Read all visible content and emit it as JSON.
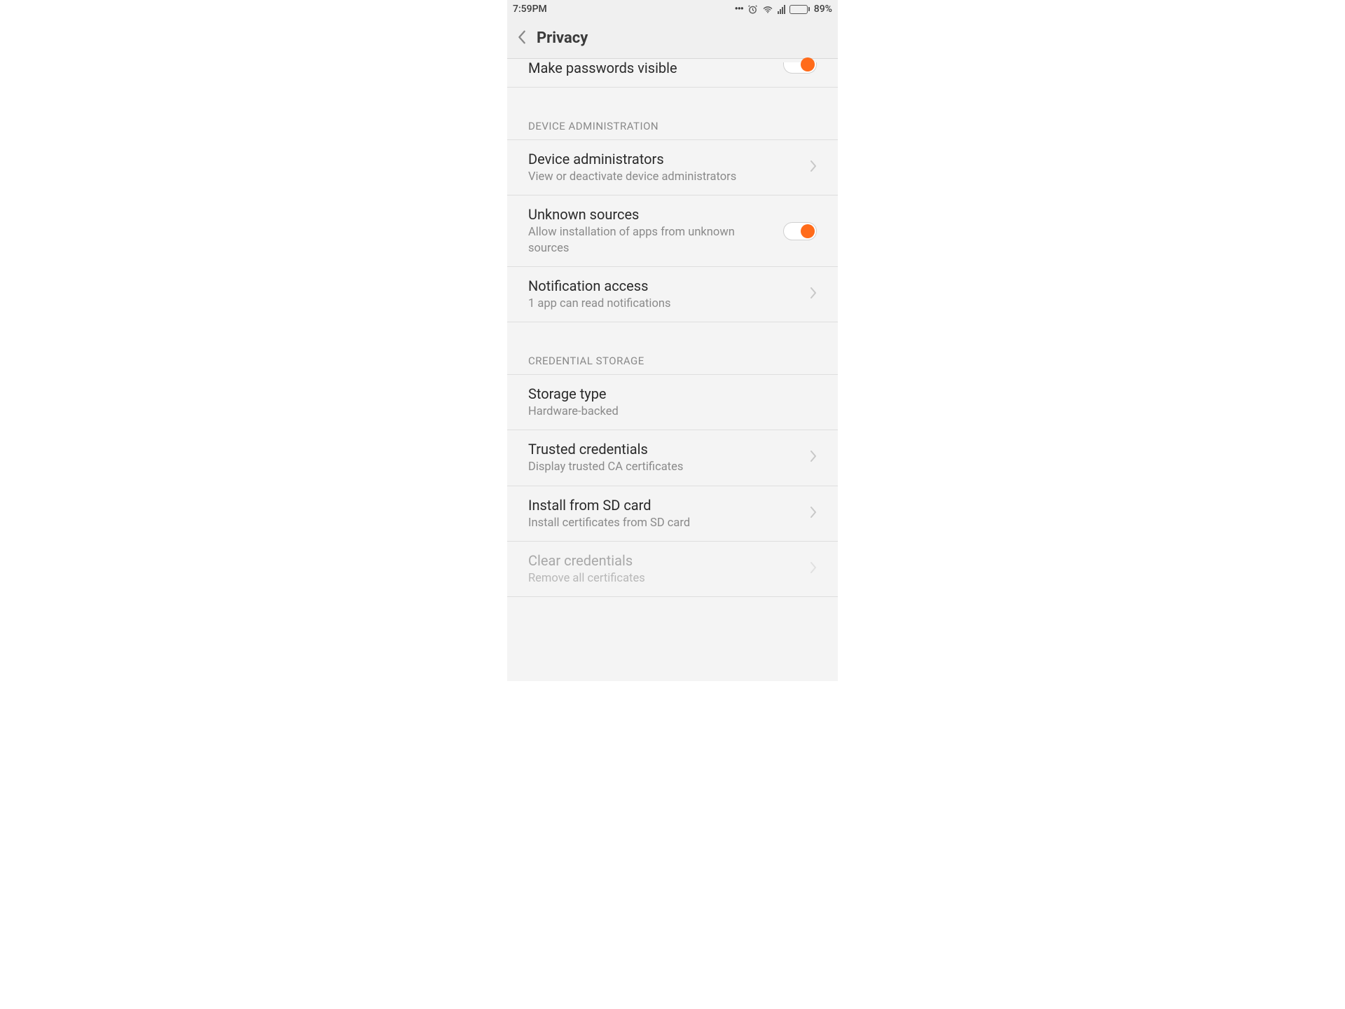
{
  "status_bar": {
    "time": "7:59PM",
    "battery_percent": "89%"
  },
  "header": {
    "title": "Privacy"
  },
  "rows": {
    "make_passwords_visible": {
      "title": "Make passwords visible"
    }
  },
  "sections": {
    "device_admin": {
      "header": "DEVICE ADMINISTRATION",
      "device_administrators": {
        "title": "Device administrators",
        "subtitle": "View or deactivate device administrators"
      },
      "unknown_sources": {
        "title": "Unknown sources",
        "subtitle": "Allow installation of apps from unknown sources"
      },
      "notification_access": {
        "title": "Notification access",
        "subtitle": "1 app can read notifications"
      }
    },
    "credential_storage": {
      "header": "CREDENTIAL STORAGE",
      "storage_type": {
        "title": "Storage type",
        "subtitle": "Hardware-backed"
      },
      "trusted_credentials": {
        "title": "Trusted credentials",
        "subtitle": "Display trusted CA certificates"
      },
      "install_sd": {
        "title": "Install from SD card",
        "subtitle": "Install certificates from SD card"
      },
      "clear_credentials": {
        "title": "Clear credentials",
        "subtitle": "Remove all certificates"
      }
    }
  }
}
